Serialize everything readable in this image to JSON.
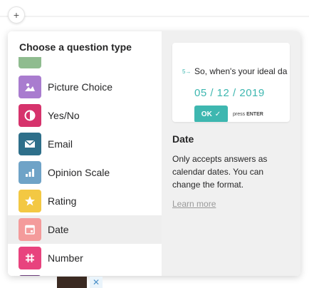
{
  "add_button": {
    "label": "+"
  },
  "picker": {
    "title": "Choose a question type",
    "items": [
      {
        "label": "",
        "color": "#8fbc8f",
        "icon": "partial-icon"
      },
      {
        "label": "Picture Choice",
        "color": "#a97ccf",
        "icon": "image-icon"
      },
      {
        "label": "Yes/No",
        "color": "#d6336c",
        "icon": "yes-no-icon"
      },
      {
        "label": "Email",
        "color": "#2e6f8a",
        "icon": "envelope-icon"
      },
      {
        "label": "Opinion Scale",
        "color": "#6fa3c7",
        "icon": "bar-chart-icon"
      },
      {
        "label": "Rating",
        "color": "#f3c843",
        "icon": "star-icon"
      },
      {
        "label": "Date",
        "color": "#f49b9b",
        "icon": "calendar-icon",
        "active": true
      },
      {
        "label": "Number",
        "color": "#e8437e",
        "icon": "hash-icon"
      },
      {
        "label": "",
        "color": "#6a3c7a",
        "icon": "partial-icon"
      }
    ]
  },
  "preview": {
    "question_number": "5→",
    "question_text": "So, when's your ideal da",
    "date_value": "05 / 12 / 2019",
    "ok_label": "OK",
    "ok_check": "✓",
    "hint_prefix": "press ",
    "hint_key": "ENTER"
  },
  "detail": {
    "title": "Date",
    "description": "Only accepts answers as calendar dates. You can change the format.",
    "learn_more": "Learn more"
  },
  "thumbnail": {
    "close": "✕"
  },
  "colors": {
    "accent": "#3eb7b0"
  }
}
